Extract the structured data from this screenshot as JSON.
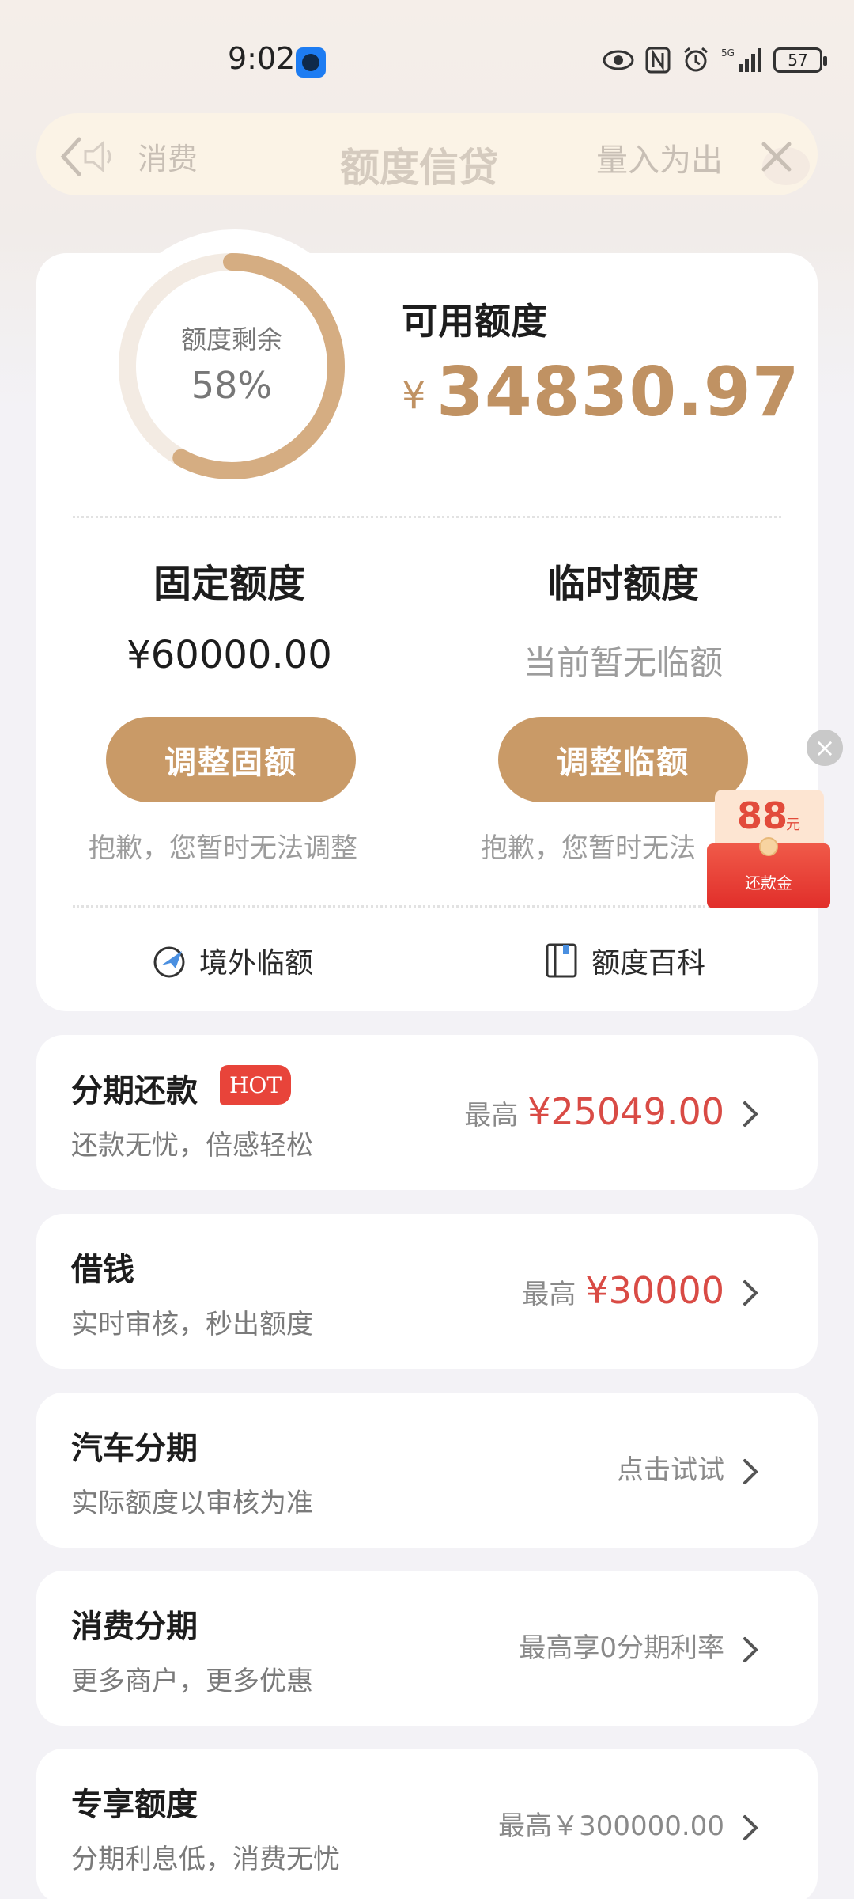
{
  "status_bar": {
    "time": "9:02",
    "battery": "57"
  },
  "ticker": {
    "left": "消费",
    "title": "额度信贷",
    "right": "量入为出"
  },
  "quota": {
    "ring_label": "额度剩余",
    "ring_percent": "58%",
    "ring_fraction": 0.58,
    "available_label": "可用额度",
    "available_currency": "¥",
    "available_amount": "34830.97",
    "fixed": {
      "title": "固定额度",
      "value": "¥60000.00",
      "button": "调整固额",
      "note": "抱歉，您暂时无法调整"
    },
    "temp": {
      "title": "临时额度",
      "value": "当前暂无临额",
      "button": "调整临额",
      "note": "抱歉，您暂时无法"
    },
    "links": {
      "overseas": "境外临额",
      "wiki": "额度百科"
    }
  },
  "red_packet": {
    "amount": "88",
    "unit": "元",
    "label": "还款金"
  },
  "list": [
    {
      "title": "分期还款",
      "badge": "HOT",
      "sub": "还款无忧，倍感轻松",
      "prefix": "最高",
      "amount": "¥25049.00"
    },
    {
      "title": "借钱",
      "sub": "实时审核，秒出额度",
      "prefix": "最高",
      "amount": "¥30000"
    },
    {
      "title": "汽车分期",
      "sub": "实际额度以审核为准",
      "plain": "点击试试"
    },
    {
      "title": "消费分期",
      "sub": "更多商户，更多优惠",
      "plain": "最高享0分期利率"
    },
    {
      "title": "专享额度",
      "sub": "分期利息低，消费无忧",
      "plain": "最高￥300000.00"
    }
  ],
  "colors": {
    "accent": "#c99a67",
    "amount_red": "#d94b45",
    "gold_text": "#c09263"
  }
}
